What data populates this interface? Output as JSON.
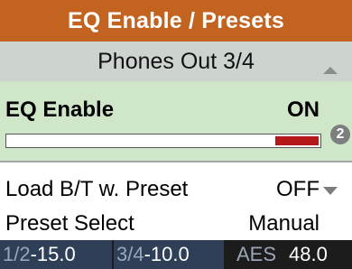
{
  "header": {
    "title": "EQ Enable / Presets",
    "subtitle": "Phones Out 3/4"
  },
  "eq_enable": {
    "label": "EQ Enable",
    "value": "ON",
    "level_fraction": 0.14,
    "bar_color": "#b41818",
    "badge": "2"
  },
  "load_bt": {
    "label": "Load B/T w. Preset",
    "value": "OFF"
  },
  "preset_select": {
    "label": "Preset Select",
    "value": "Manual"
  },
  "status": {
    "meter1": {
      "channel": "1/2",
      "value": "-15.0"
    },
    "meter2": {
      "channel": "3/4",
      "value": "-10.0"
    },
    "aes": {
      "label": "AES",
      "value": "48.0"
    }
  },
  "colors": {
    "title_bg": "#c2631f",
    "subtitle_bg": "#cdd4d0",
    "selected_row_bg": "#cfe6c8",
    "status_bg": "#1c1c1c",
    "meter_bg": "#2f3f58"
  }
}
